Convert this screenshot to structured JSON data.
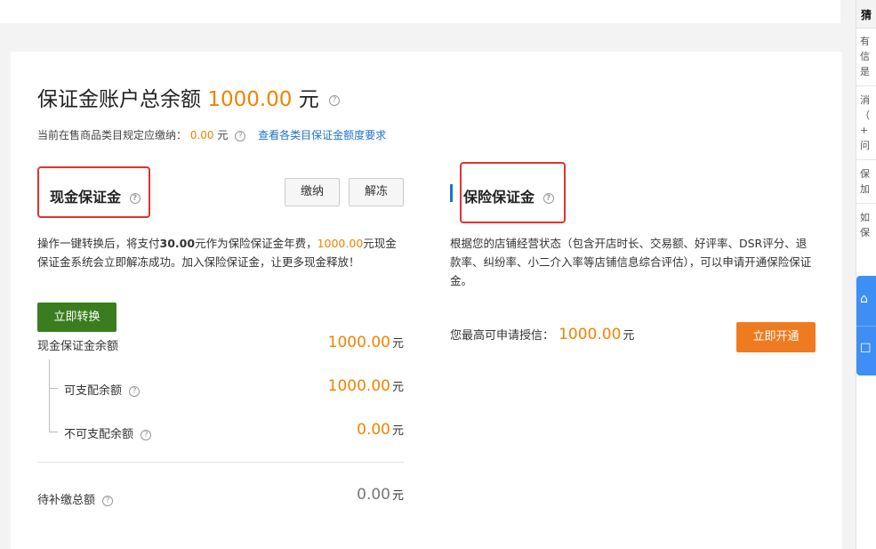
{
  "title": {
    "text": "保证金账户总余额",
    "amount": "1000.00",
    "unit": "元",
    "help": "?"
  },
  "subline": {
    "label": "当前在售商品类目规定应缴纳：",
    "amount": "0.00",
    "unit": "元",
    "help": "?",
    "link": "查看各类目保证金额度要求"
  },
  "cash": {
    "title": "现金保证金",
    "help": "?",
    "pay_button": "缴纳",
    "unfreeze_button": "解冻",
    "desc_part1": "操作一键转换后，将支付",
    "desc_bold": "30.00",
    "desc_part2": "元作为保险保证金年费，",
    "desc_amount": "1000.00",
    "desc_part3": "元现金保证金系统会立即解冻成功。加入保险保证金，让更多现金释放！",
    "convert_button": "立即转换",
    "balance_label": "现金保证金余额",
    "balance_value": "1000.00",
    "available_label": "可支配余额",
    "available_value": "1000.00",
    "unavailable_label": "不可支配余额",
    "unavailable_value": "0.00",
    "pending_label": "待补缴总额",
    "pending_value": "0.00",
    "unit": "元"
  },
  "insurance": {
    "title": "保险保证金",
    "help": "?",
    "desc": "根据您的店铺经营状态（包含开店时长、交易额、好评率、DSR评分、退款率、纠纷率、小二介入率等店铺信息综合评估），可以申请开通保险保证金。",
    "credit_label": "您最高可申请授信：",
    "credit_value": "1000.00",
    "unit": "元",
    "open_button": "立即开通"
  },
  "side_panel": {
    "head": "猜",
    "lines": [
      "有",
      "信",
      "是",
      "消",
      "（",
      "+",
      "问",
      "保",
      "加",
      "如",
      "保"
    ],
    "icon_top": "⌂",
    "icon_bottom": "☐"
  },
  "colors": {
    "accent_orange": "#f08300",
    "link_blue": "#1e73c8",
    "highlight_red": "#e03232",
    "green_button": "#3a7d1f",
    "orange_button": "#ef7b21"
  }
}
